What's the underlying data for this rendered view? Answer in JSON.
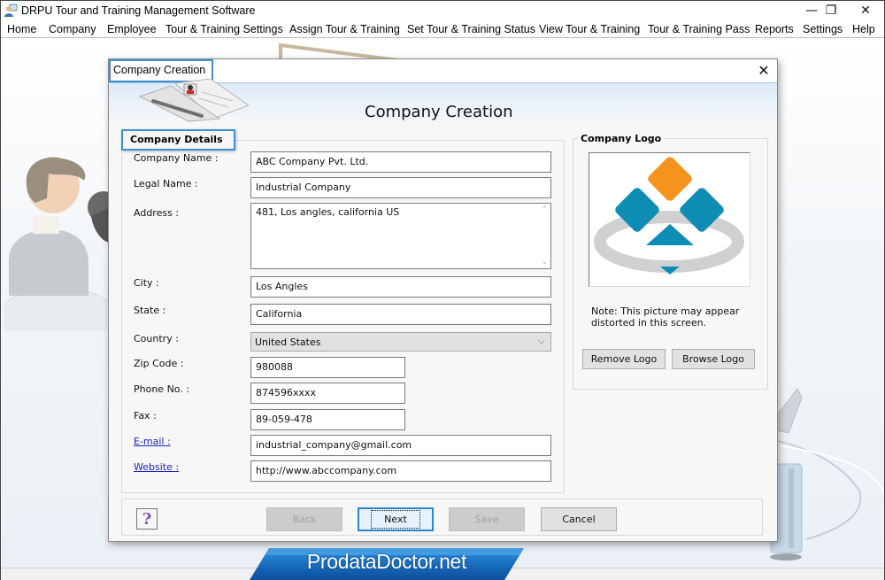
{
  "app": {
    "title": "DRPU Tour and Training Management Software",
    "window_controls": {
      "minimize": "—",
      "maximize": "❐",
      "close": "✕"
    }
  },
  "menu": [
    {
      "label": "Home"
    },
    {
      "label": "Company"
    },
    {
      "label": "Employee"
    },
    {
      "label": "Tour & Training Settings"
    },
    {
      "label": "Assign Tour & Training"
    },
    {
      "label": "Set Tour & Training Status"
    },
    {
      "label": "View Tour & Training"
    },
    {
      "label": "Tour & Training Pass"
    },
    {
      "label": "Reports"
    },
    {
      "label": "Settings"
    },
    {
      "label": "Help"
    }
  ],
  "dialog": {
    "title": "Company Creation",
    "close_glyph": "✕",
    "heading": "Company Creation",
    "details_group": "Company Details",
    "fields": {
      "company_name": {
        "label": "Company Name :",
        "value": "ABC Company Pvt. Ltd."
      },
      "legal_name": {
        "label": "Legal Name :",
        "value": "Industrial Company"
      },
      "address": {
        "label": "Address :",
        "value": "481, Los angles, california US"
      },
      "city": {
        "label": "City :",
        "value": "Los Angles"
      },
      "state": {
        "label": "State :",
        "value": "California"
      },
      "country": {
        "label": "Country :",
        "value": "United States"
      },
      "zip": {
        "label": "Zip Code :",
        "value": "980088"
      },
      "phone": {
        "label": "Phone No. :",
        "value": "874596xxxx"
      },
      "fax": {
        "label": "Fax :",
        "value": "89-059-478"
      },
      "email": {
        "label": "E-mail :",
        "value": "industrial_company@gmail.com"
      },
      "website": {
        "label": "Website :",
        "value": "http://www.abccompany.com"
      }
    },
    "logo_group": {
      "title": "Company Logo",
      "note": "Note: This picture may appear distorted in this screen.",
      "remove_label": "Remove Logo",
      "browse_label": "Browse Logo",
      "colors": {
        "orange": "#f4941e",
        "teal": "#0e8db4",
        "ring": "#cfd0d2"
      }
    },
    "footer": {
      "help_glyph": "?",
      "back_label": "Back",
      "next_label": "Next",
      "save_label": "Save",
      "cancel_label": "Cancel"
    }
  },
  "branding": {
    "text": "ProdataDoctor.net"
  },
  "icons": {
    "chevron_down": "⌵",
    "scroll_up": "⌃",
    "scroll_down": "⌄"
  }
}
